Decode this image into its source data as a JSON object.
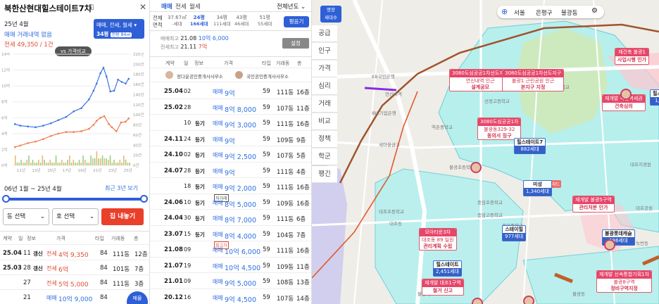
{
  "left": {
    "title": "북한산현대힐스테이트7차",
    "date": "25년 4월",
    "notice": "매매 거래내역 없음",
    "price_summary": "전세 49,350 / 1건",
    "filter_pill": "매매, 전세, 월세",
    "area_pill": "34평",
    "area_sub": "전용 84㎡",
    "compare_label": "vs 가격비교",
    "range_text": "06년 1월 ~ 25년 4월",
    "recent_link": "최근 3년 보기",
    "dong_select": "동 선택",
    "ho_select": "호 선택",
    "register_button": "집 내놓기",
    "headers": [
      "계약",
      "일",
      "정보",
      "가격",
      "타입",
      "거래동",
      "층"
    ],
    "rows": [
      {
        "ym": "25.04",
        "d": "11",
        "info": "갱신",
        "kind": "전세",
        "price": "4억 9,350",
        "type": "84",
        "dong": "111동",
        "floor": "12층"
      },
      {
        "ym": "25.03",
        "d": "28",
        "info": "갱신",
        "kind": "전세",
        "price": "6억",
        "type": "84",
        "dong": "101동",
        "floor": "7층"
      },
      {
        "ym": "",
        "d": "27",
        "info": "",
        "kind": "전세",
        "price": "5억 5,000",
        "type": "84",
        "dong": "111동",
        "floor": "3층"
      },
      {
        "ym": "",
        "d": "21",
        "info": "",
        "kind": "매매",
        "price": "10억 9,000",
        "type": "84",
        "dong": "",
        "floor": ""
      }
    ],
    "chat_badge": "매물",
    "chart_data": {
      "type": "line",
      "x_ticks": [
        "11년",
        "13년",
        "15년",
        "17년",
        "19년",
        "21년",
        "23년",
        "25년"
      ],
      "y_left_ticks": [
        "14억",
        "12억",
        "10억",
        "8억",
        "6억",
        "4억",
        "2억",
        "0억"
      ],
      "y_right_ticks": [
        "220건",
        "200건",
        "180건",
        "160건",
        "140건",
        "120건",
        "100건",
        "80건",
        "60건",
        "40건",
        "20건",
        "0건"
      ],
      "ylim": [
        0,
        14
      ],
      "x_range": [
        2010,
        2025.5
      ],
      "series": [
        {
          "color": "#3b73e6",
          "points": [
            [
              2010.3,
              5.2
            ],
            [
              2011,
              5.0
            ],
            [
              2012,
              4.9
            ],
            [
              2013,
              4.8
            ],
            [
              2014,
              5.0
            ],
            [
              2015,
              5.3
            ],
            [
              2016,
              5.7
            ],
            [
              2017,
              6.1
            ],
            [
              2018,
              6.8
            ],
            [
              2019,
              7.2
            ],
            [
              2020,
              8.3
            ],
            [
              2020.6,
              9.4
            ],
            [
              2021,
              10.3
            ],
            [
              2021.5,
              11.6
            ],
            [
              2021.9,
              12.3
            ],
            [
              2022.3,
              11.2
            ],
            [
              2022.8,
              9.3
            ],
            [
              2023.3,
              9.4
            ],
            [
              2023.8,
              10.8
            ],
            [
              2024.3,
              10.5
            ],
            [
              2024.8,
              10.3
            ],
            [
              2025.2,
              10.9
            ]
          ]
        },
        {
          "color": "#f07a4a",
          "points": [
            [
              2010.3,
              2.3
            ],
            [
              2011,
              2.5
            ],
            [
              2012,
              2.8
            ],
            [
              2013,
              3.0
            ],
            [
              2014,
              3.3
            ],
            [
              2015,
              3.7
            ],
            [
              2016,
              4.0
            ],
            [
              2017,
              4.2
            ],
            [
              2018,
              4.2
            ],
            [
              2019,
              4.3
            ],
            [
              2020,
              4.6
            ],
            [
              2020.6,
              5.1
            ],
            [
              2021,
              5.6
            ],
            [
              2021.5,
              6.0
            ],
            [
              2022,
              6.2
            ],
            [
              2022.6,
              5.2
            ],
            [
              2023,
              4.8
            ],
            [
              2023.6,
              4.3
            ],
            [
              2024.2,
              5.4
            ],
            [
              2024.8,
              5.5
            ],
            [
              2025.2,
              5.9
            ]
          ]
        }
      ]
    }
  },
  "mid": {
    "tabs": [
      "매매",
      "전세",
      "월세"
    ],
    "year_select": "전체년도",
    "area_label_1": "전체",
    "area_label_2": "면적",
    "areas": [
      {
        "top": "37.67㎡",
        "bottom": "-세대"
      },
      {
        "top": "24평",
        "bottom": "166세대"
      },
      {
        "top": "34평",
        "bottom": "111세대"
      },
      {
        "top": "43평",
        "bottom": "46세대"
      },
      {
        "top": "51평",
        "bottom": "55세대"
      }
    ],
    "graph_button": "평음기",
    "high_label": "매매최고",
    "high_date": "21.08",
    "high_price": "10억 6,000",
    "jeonse_label": "전세최고",
    "jeonse_date": "21.11",
    "jeonse_price": "7억",
    "settings_button": "설정",
    "headers": [
      "계약",
      "일",
      "정보",
      "가격",
      "타입",
      "거래동",
      "층"
    ],
    "agent1": "정다운공인중개사사무소",
    "agent2": "국민공인중개사사무소",
    "rows": [
      {
        "ym": "25.04",
        "d": "02",
        "info": "",
        "kind": "매매",
        "price": "9억",
        "type": "59",
        "dong": "111동",
        "floor": "16층"
      },
      {
        "ym": "25.02",
        "d": "28",
        "info": "",
        "kind": "매매",
        "price": "8억 8,000",
        "type": "59",
        "dong": "107동",
        "floor": "11층"
      },
      {
        "ym": "",
        "d": "10",
        "info": "등기",
        "kind": "매매",
        "price": "9억 3,000",
        "type": "59",
        "dong": "111동",
        "floor": "16층"
      },
      {
        "ym": "24.11",
        "d": "24",
        "info": "등기",
        "kind": "매매",
        "price": "9억",
        "type": "59",
        "dong": "109동",
        "floor": "9층"
      },
      {
        "ym": "24.10",
        "d": "02",
        "info": "등기",
        "kind": "매매",
        "price": "9억 2,500",
        "type": "59",
        "dong": "107동",
        "floor": "5층"
      },
      {
        "ym": "24.07",
        "d": "28",
        "info": "등기",
        "kind": "매매",
        "price": "9억",
        "type": "59",
        "dong": "111동",
        "floor": "4층"
      },
      {
        "ym": "",
        "d": "18",
        "info": "등기",
        "kind": "매매",
        "price": "9억 2,000",
        "type": "59",
        "dong": "111동",
        "floor": "16층"
      },
      {
        "ym": "24.06",
        "d": "10",
        "info": "등기",
        "kind": "매매",
        "price": "8억 5,000",
        "type": "59",
        "dong": "109동",
        "floor": "16층",
        "tag": "직거래"
      },
      {
        "ym": "24.04",
        "d": "30",
        "info": "등기",
        "kind": "매매",
        "price": "8억 7,000",
        "type": "59",
        "dong": "111동",
        "floor": "6층"
      },
      {
        "ym": "23.07",
        "d": "15",
        "info": "등기",
        "kind": "매매",
        "price": "8억 4,000",
        "type": "59",
        "dong": "104동",
        "floor": "7층"
      },
      {
        "ym": "21.08",
        "d": "09",
        "info": "",
        "kind": "매매",
        "price": "10억 6,000",
        "type": "59",
        "dong": "111동",
        "floor": "16층",
        "tag": "최고가"
      },
      {
        "ym": "21.07",
        "d": "19",
        "info": "",
        "kind": "매매",
        "price": "10억 4,500",
        "type": "59",
        "dong": "109동",
        "floor": "11층"
      },
      {
        "ym": "21.01",
        "d": "09",
        "info": "",
        "kind": "매매",
        "price": "9억 5,000",
        "type": "59",
        "dong": "108동",
        "floor": "13층"
      },
      {
        "ym": "20.12",
        "d": "16",
        "info": "",
        "kind": "매매",
        "price": "9억 4,500",
        "type": "59",
        "dong": "107동",
        "floor": "14층"
      }
    ]
  },
  "map": {
    "side_tabs": [
      "공급",
      "인구",
      "가격",
      "심리",
      "거래",
      "비교",
      "정책",
      "학군",
      "팽긴"
    ],
    "top_badge_1": "명장",
    "top_badge_2": "세대수",
    "region_1": "서울",
    "region_2": "은평구",
    "region_3": "불광동",
    "pois": [
      "연신내역",
      "KB국민은행",
      "IBK기업은행",
      "세마을금고",
      "역촌중학교",
      "선정고등학교",
      "불광역",
      "대조초등학교",
      "불광초등학교",
      "대조동",
      "불광동",
      "녹번동",
      "대호지경원",
      "대호공원",
      "연신초등학교",
      "충암초등학교",
      "충암고등학교",
      "충암중학교"
    ],
    "labels_red": [
      {
        "t": "3080도심공공1차선도지구",
        "s": "연신내역 인근",
        "c": "설계공모"
      },
      {
        "t": "3080도심공공1차선도지구",
        "s": "불광1 근린공원 인근",
        "c": "본지구 지정"
      },
      {
        "t": "3080도심공공1차",
        "s": "불광동329-32",
        "c": "동의서 징구"
      },
      {
        "t": "재건축 불광1",
        "s": "",
        "c": "사업시행 인가"
      },
      {
        "t": "재개발 녹번역세권",
        "s": "",
        "c": "건축심의"
      },
      {
        "t": "재개발 불광5구역",
        "s": "",
        "c": "관리처분 인가"
      },
      {
        "t": "모아타운3차",
        "s": "대조동 89 일원",
        "c": "관리계획 수립"
      },
      {
        "t": "재개발 대조1구역",
        "s": "",
        "c": "철거 신고"
      },
      {
        "t": "재개발 신속통합기획1차",
        "s": "불광8구역",
        "c": "정비구역지정"
      }
    ],
    "labels_blue": [
      {
        "t": "힐스테이트7",
        "c": "882세대"
      },
      {
        "t": "미성",
        "c": "1,340세대"
      },
      {
        "t": "스테이힐",
        "c": "977세대"
      },
      {
        "t": "힐스테이트",
        "c": "2,451세대"
      },
      {
        "t": "불광롯데캐슬",
        "c": "586세대"
      },
      {
        "t": "힐스",
        "c": "1,"
      }
    ],
    "tag_pad": "파드"
  }
}
